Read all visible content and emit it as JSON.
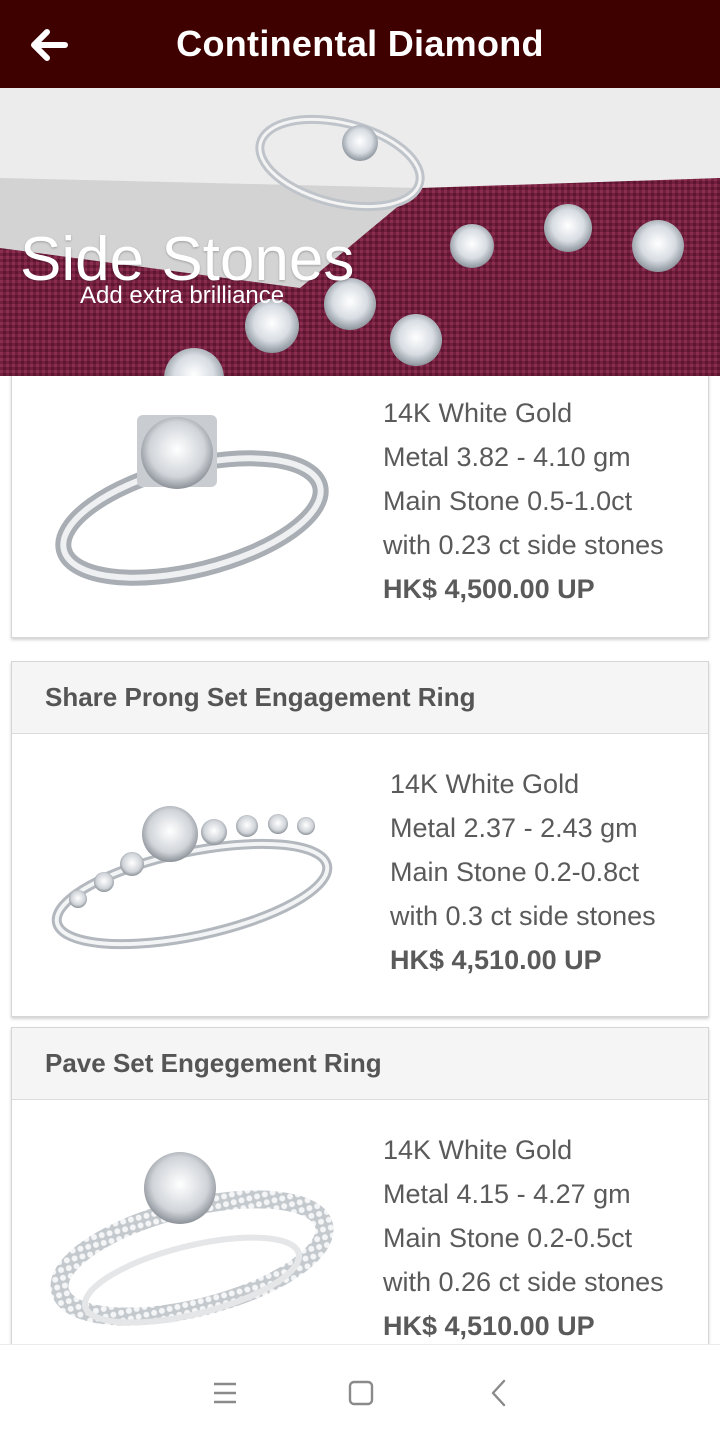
{
  "app": {
    "title": "Continental Diamond"
  },
  "hero": {
    "title": "Side Stones",
    "subtitle": "Add extra brilliance"
  },
  "products": [
    {
      "name": "",
      "metal": "14K White Gold",
      "weight": "Metal 3.82 - 4.10 gm",
      "main_stone": "Main Stone 0.5-1.0ct",
      "side_stones": "with 0.23 ct side stones",
      "price": "HK$ 4,500.00 UP"
    },
    {
      "name": "Share Prong Set Engagement Ring",
      "metal": "14K White Gold",
      "weight": "Metal 2.37 - 2.43 gm",
      "main_stone": "Main Stone 0.2-0.8ct",
      "side_stones": "with 0.3 ct side stones",
      "price": "HK$ 4,510.00 UP"
    },
    {
      "name": "Pave Set Engegement Ring",
      "metal": "14K White Gold",
      "weight": "Metal 4.15 - 4.27 gm",
      "main_stone": "Main Stone 0.2-0.5ct",
      "side_stones": "with 0.26 ct side stones",
      "price": "HK$ 4,510.00 UP"
    }
  ],
  "icons": {
    "back": "arrow-left-icon",
    "nav_menu": "menu-icon",
    "nav_home": "square-home-icon",
    "nav_back": "chevron-left-icon"
  },
  "colors": {
    "appbar": "#3f0000",
    "text": "#5a5a5a"
  }
}
